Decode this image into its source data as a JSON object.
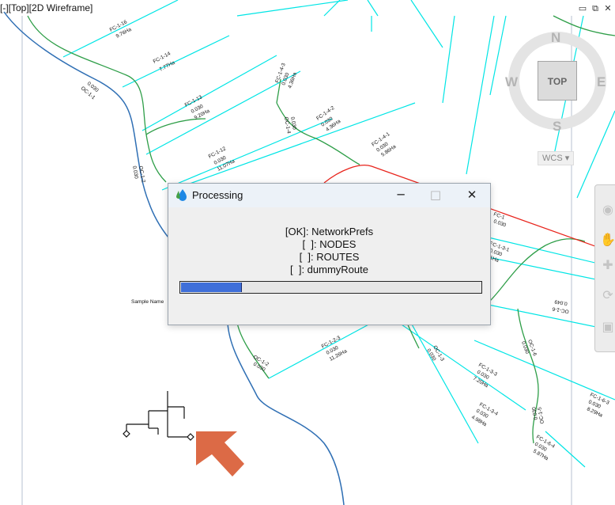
{
  "viewport": {
    "label": "[-][Top][2D Wireframe]"
  },
  "window_controls": {
    "minimize_icon": "minimize-icon",
    "restore_icon": "restore-icon",
    "close_icon": "close-icon"
  },
  "viewcube": {
    "north": "N",
    "west": "W",
    "east": "E",
    "south": "S",
    "face": "TOP",
    "ucs_menu": "WCS"
  },
  "drawing": {
    "sample_label": "Sample Name",
    "labels": [
      {
        "text": "FC-1-16",
        "sub1": "9.76Ha"
      },
      {
        "text": "FC-1-14",
        "sub1": "7.77Ha"
      },
      {
        "text": "FC-1-13",
        "sub1": "0.030",
        "sub2": "9.20Ha"
      },
      {
        "text": "FC-1-12",
        "sub1": "0.030",
        "sub2": "11.07Ha"
      },
      {
        "text": "FC-1-4-2",
        "sub1": "0.030",
        "sub2": "4.36Ha"
      },
      {
        "text": "FC-1-4-1",
        "sub1": "0.030",
        "sub2": "5.86Ha"
      },
      {
        "text": "FC-1-4-3",
        "sub1": "0.030",
        "sub2": "4.36Ha"
      },
      {
        "text": "FC-1-2-3",
        "sub1": "0.030",
        "sub2": "11.26Ha"
      },
      {
        "text": "FC-1-3-3",
        "sub1": "0.030",
        "sub2": "7.20Ha"
      },
      {
        "text": "FC-1-3-4",
        "sub1": "0.030",
        "sub2": "4.98Ha"
      },
      {
        "text": "FC-1-6-3",
        "sub1": "0.030",
        "sub2": "8.29Ha"
      },
      {
        "text": "FC-1-6-4",
        "sub1": "0.030",
        "sub2": "5.87Ha"
      },
      {
        "text": "FC-1-3-1",
        "sub1": "0.030",
        "sub2": "1Ha"
      },
      {
        "text": "FC-1",
        "sub1": "0.030"
      },
      {
        "text": "OC-1-1",
        "sub1": "0.030"
      },
      {
        "text": "OC-1-2",
        "sub1": "0.030"
      },
      {
        "text": "OC-1-4",
        "sub1": "0.030"
      },
      {
        "text": "OC-1-3",
        "sub1": "0.030"
      },
      {
        "text": "OC-1-6",
        "sub1": "0.030"
      },
      {
        "text": "OC-1-5",
        "sub1": "0.030"
      },
      {
        "text": "OC-1-6",
        "sub1": "0.049"
      },
      {
        "text": "OC-1-2",
        "sub1": "0.030"
      }
    ]
  },
  "dialog": {
    "title": "Processing",
    "app_icon": "water-drop-icon",
    "minimize_label": "─",
    "maximize_label": "□",
    "close_label": "✕",
    "status_lines": [
      "[OK]: NetworkPrefs",
      "[  ]: NODES",
      "[  ]: ROUTES",
      "[  ]: dummyRoute"
    ],
    "progress_fraction": 0.2
  },
  "colors": {
    "cyan_lines": "#00e5e5",
    "green_lines": "#2e9e48",
    "blue_river": "#2f6fb4",
    "red_line": "#e8231b",
    "arrow": "#dc6a46",
    "progress_fill": "#3f6fd9"
  }
}
